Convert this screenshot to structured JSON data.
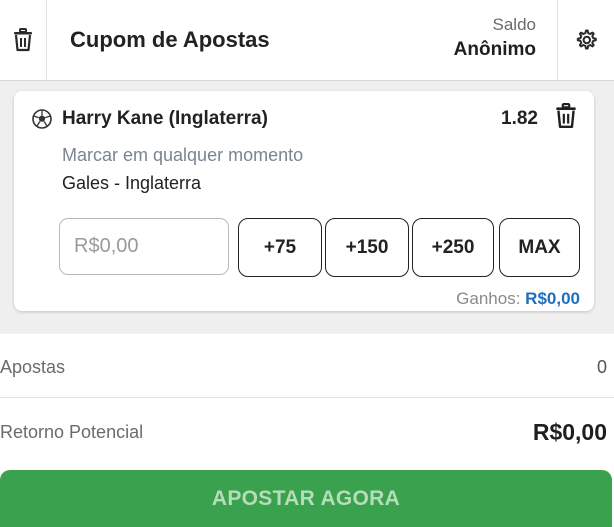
{
  "header": {
    "title": "Cupom de Apostas",
    "balance_label": "Saldo",
    "balance_value": "Anônimo",
    "trash_icon": "trash-icon",
    "settings_icon": "gear-icon"
  },
  "selection": {
    "sport_icon": "soccer-ball-icon",
    "name": "Harry Kane (Inglaterra)",
    "odds": "1.82",
    "market": "Marcar em qualquer momento",
    "match": "Gales - Inglaterra",
    "stake_placeholder": "R$0,00",
    "stake_value": "",
    "quick_stakes": [
      "+75",
      "+150",
      "+250",
      "MAX"
    ],
    "winnings_label": "Ganhos:",
    "winnings_value": "R$0,00"
  },
  "summary": {
    "bets_label": "Apostas",
    "bets_value": "0",
    "return_label": "Retorno Potencial",
    "return_value": "R$0,00"
  },
  "action": {
    "place_bet_label": "APOSTAR AGORA"
  },
  "colors": {
    "accent_green": "#3aa24f",
    "link_blue": "#1f6fbf",
    "panel_bg": "#efefef"
  }
}
